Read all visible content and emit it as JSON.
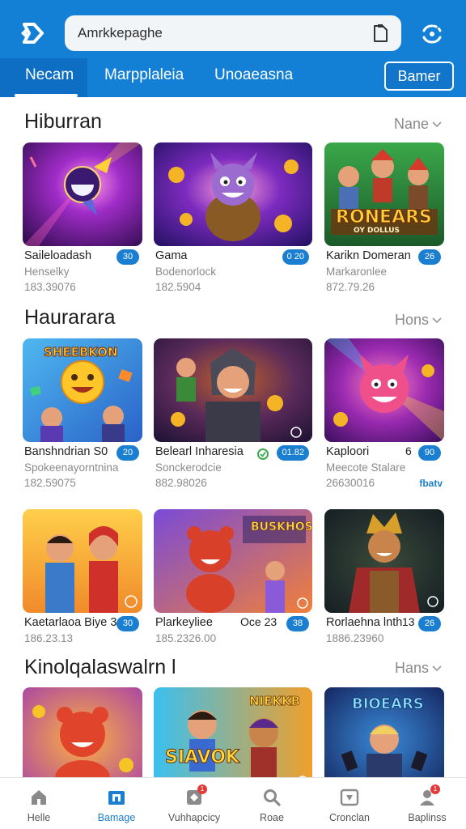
{
  "header": {
    "search_value": "Amrkkepaghe",
    "tabs": [
      "Necam",
      "Marpplaleia",
      "Unoaeasna"
    ],
    "banner_button": "Bamer"
  },
  "sections": [
    {
      "title": "Hiburran",
      "more": "Nane",
      "cards": [
        {
          "title": "Saileloadash",
          "sub": "Henselky",
          "num": "183.39076",
          "pill": "30"
        },
        {
          "title": "Gama",
          "sub": "Bodenorlock",
          "num": "182.5904",
          "pill": "0 20"
        },
        {
          "title": "Karikn Domeran",
          "sub": "Markaronlee",
          "num": "872.79.26",
          "pill": "26",
          "art_text": "RONEARS",
          "art_sub": "OY DOLLUS"
        }
      ]
    },
    {
      "title": "Haurarara",
      "more": "Hons",
      "cards": [
        {
          "title": "Banshndrian S0",
          "sub": "Spokeenayorntnina",
          "num": "182.59075",
          "pill": "20",
          "art_text": "SHEEBKON"
        },
        {
          "title": "Belearl Inharesia",
          "sub": "Sonckerodcie",
          "num": "882.98026",
          "pill": "01.82"
        },
        {
          "title": "Kaploori",
          "sub": "Meecote Stalare",
          "num": "26630016",
          "pill": "90",
          "extra": "6",
          "link": "fbatv"
        }
      ]
    },
    {
      "title": "",
      "more": "",
      "cards": [
        {
          "title": "Kaetarlaoa Biye 3",
          "sub": "",
          "num": "186.23.13",
          "pill": "30"
        },
        {
          "title": "Plarkeyliee",
          "sub": "",
          "num": "185.2326.00",
          "pill": "38",
          "extra": "Oce 23",
          "art_text": "BUSKHOS"
        },
        {
          "title": "Rorlaehna lnth",
          "sub": "",
          "num": "1886.23960",
          "pill": "26",
          "extra": "13"
        }
      ]
    },
    {
      "title": "Kinolqalaswalrn l",
      "more": "Hans",
      "cards": [
        {
          "title": "",
          "sub": "",
          "num": "",
          "pill": ""
        },
        {
          "title": "",
          "sub": "",
          "num": "",
          "pill": "",
          "art_text": "SIAVOK",
          "art_text2": "NIEKKB"
        },
        {
          "title": "",
          "sub": "",
          "num": "",
          "pill": "",
          "art_text": "BIOEARS"
        }
      ]
    }
  ],
  "bottom_nav": [
    {
      "label": "Helle",
      "icon": "home-icon"
    },
    {
      "label": "Bamage",
      "icon": "store-icon",
      "active": true
    },
    {
      "label": "Vuhhapcicy",
      "icon": "puzzle-icon",
      "badge": "1"
    },
    {
      "label": "Roae",
      "icon": "search-icon"
    },
    {
      "label": "Cronclan",
      "icon": "wallet-icon"
    },
    {
      "label": "Baplinss",
      "icon": "profile-icon",
      "badge": "1"
    }
  ],
  "colors": {
    "primary": "#1380d6",
    "pill": "#1a7fd0",
    "badge": "#e23b3b"
  }
}
